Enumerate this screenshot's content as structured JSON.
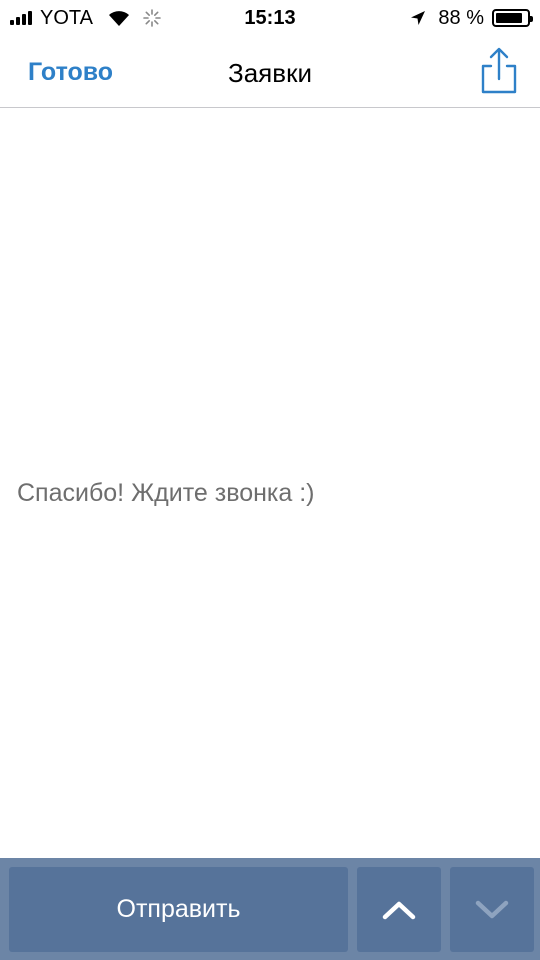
{
  "status_bar": {
    "carrier": "YOTA",
    "time": "15:13",
    "battery_percent": "88 %",
    "battery_level": 0.88,
    "signal_bars": 4,
    "icons": [
      "signal-icon",
      "wifi-icon",
      "activity-spinner-icon",
      "location-arrow-icon",
      "battery-icon"
    ]
  },
  "nav": {
    "done_label": "Готово",
    "title": "Заявки",
    "share_icon": "share-icon",
    "accent_color": "#2e80c8"
  },
  "content": {
    "message": "Спасибо! Ждите звонка :)"
  },
  "toolbar": {
    "send_label": "Отправить",
    "up_icon": "chevron-up-icon",
    "down_icon": "chevron-down-icon",
    "bar_color": "#6c85a6",
    "button_color": "#56739a"
  }
}
